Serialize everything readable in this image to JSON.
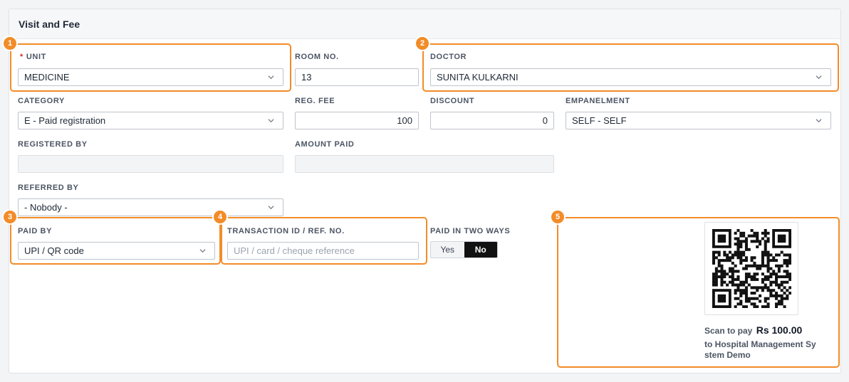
{
  "section": {
    "title": "Visit and Fee"
  },
  "fields": {
    "unit": {
      "label": "UNIT",
      "required_mark": "*",
      "value": "MEDICINE"
    },
    "room_no": {
      "label": "ROOM NO.",
      "value": "13"
    },
    "doctor": {
      "label": "DOCTOR",
      "value": "SUNITA KULKARNI"
    },
    "category": {
      "label": "CATEGORY",
      "value": "E - Paid registration"
    },
    "reg_fee": {
      "label": "REG. FEE",
      "value": "100"
    },
    "discount": {
      "label": "DISCOUNT",
      "value": "0"
    },
    "empanelment": {
      "label": "EMPANELMENT",
      "value": "SELF - SELF"
    },
    "registered_by": {
      "label": "REGISTERED BY",
      "value": ""
    },
    "amount_paid": {
      "label": "AMOUNT PAID",
      "value": ""
    },
    "referred_by": {
      "label": "REFERRED BY",
      "value": "- Nobody -"
    },
    "paid_by": {
      "label": "PAID BY",
      "value": "UPI / QR code"
    },
    "transaction_id": {
      "label": "TRANSACTION ID / REF. NO.",
      "placeholder": "UPI / card / cheque reference",
      "value": ""
    },
    "paid_two_ways": {
      "label": "PAID IN TWO WAYS",
      "options": [
        "Yes",
        "No"
      ],
      "selected": "No"
    }
  },
  "qr": {
    "scan_text": "Scan to pay",
    "amount": "Rs 100.00",
    "payee": "to Hospital Management System Demo"
  },
  "annotations": [
    "1",
    "2",
    "3",
    "4",
    "5"
  ],
  "colors": {
    "highlight": "#f28c28",
    "toggle_active": "#111111",
    "required": "#dc2626"
  },
  "icons": {
    "dropdown": "chevron-down-icon",
    "qr": "qr-code-icon"
  }
}
